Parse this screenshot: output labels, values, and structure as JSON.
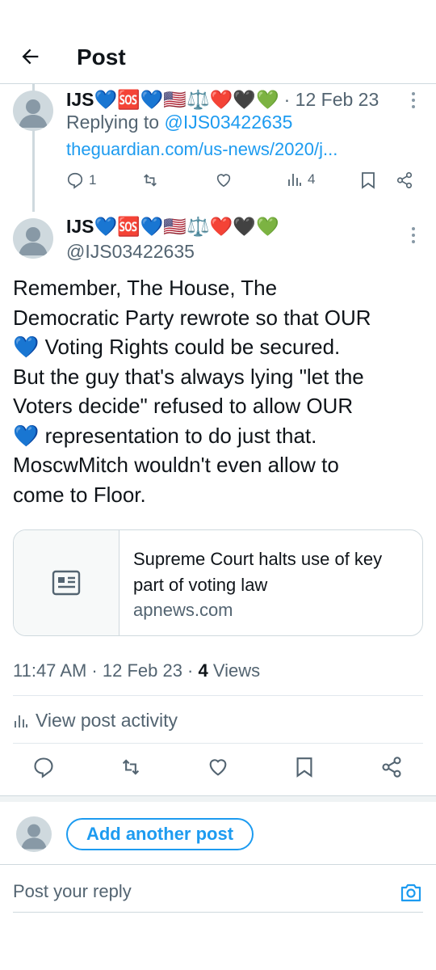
{
  "header": {
    "title": "Post"
  },
  "parent_post": {
    "display_name": "IJS💙🆘💙🇺🇸⚖️❤️🖤💚",
    "date": "· 12 Feb 23",
    "replying_prefix": "Replying to ",
    "replying_handle": "@IJS03422635",
    "link_text": "theguardian.com/us-news/2020/j...",
    "reply_count": "1",
    "views_count": "4"
  },
  "main_post": {
    "display_name": "IJS💙🆘💙🇺🇸⚖️❤️🖤💚",
    "handle": "@IJS03422635",
    "body_lines": [
      "Remember, The House, The",
      "Democratic Party rewrote so that OUR",
      "💙 Voting Rights could be secured.",
      "But the guy that's always lying \"let the",
      "Voters decide\" refused to allow OUR",
      "💙 representation to do just that.",
      "MoscwMitch wouldn't even allow to",
      "come to Floor."
    ],
    "card": {
      "title": "Supreme Court halts use of key part of voting law",
      "domain": "apnews.com"
    },
    "time": "11:47 AM · 12 Feb 23 · ",
    "views_number": "4",
    "views_label": " Views",
    "activity_label": "View post activity"
  },
  "composer": {
    "add_another_label": "Add another post",
    "reply_placeholder": "Post your reply"
  },
  "icons": {
    "back": "arrow-left-icon",
    "more": "more-vertical-icon",
    "reply": "reply-icon",
    "repost": "repost-icon",
    "like": "heart-icon",
    "views": "views-bar-chart-icon",
    "bookmark": "bookmark-icon",
    "share": "share-icon",
    "news": "news-article-icon",
    "camera": "camera-icon"
  },
  "colors": {
    "accent": "#1d9bf0",
    "muted": "#536471",
    "border": "#cfd9de"
  }
}
